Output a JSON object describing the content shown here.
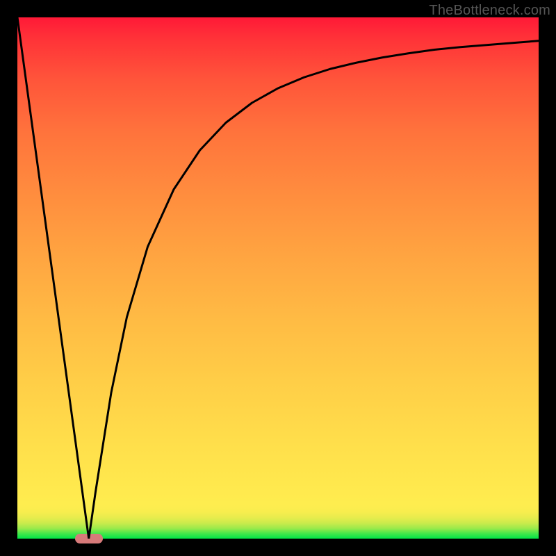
{
  "attribution": "TheBottleneck.com",
  "chart_data": {
    "type": "line",
    "title": "",
    "xlabel": "",
    "ylabel": "",
    "xlim": [
      0,
      100
    ],
    "ylim": [
      0,
      100
    ],
    "x": [
      0,
      2,
      4,
      6,
      8,
      10,
      12,
      13.7,
      15,
      18,
      21,
      25,
      30,
      35,
      40,
      45,
      50,
      55,
      60,
      65,
      70,
      75,
      80,
      85,
      90,
      95,
      100
    ],
    "values": [
      100,
      85.4,
      70.8,
      56.2,
      41.6,
      27,
      12.4,
      0,
      9,
      28,
      42.5,
      56,
      67,
      74.5,
      79.8,
      83.6,
      86.4,
      88.5,
      90.1,
      91.3,
      92.3,
      93.1,
      93.8,
      94.3,
      94.7,
      95.1,
      95.5
    ],
    "marker": {
      "x": 13.7,
      "y": 0,
      "shape": "pill",
      "color": "#d77a7a"
    }
  },
  "layout": {
    "frame_size": 800,
    "plot_inset": 25,
    "plot_size": 750,
    "stroke_color": "#000000",
    "stroke_width": 3
  }
}
